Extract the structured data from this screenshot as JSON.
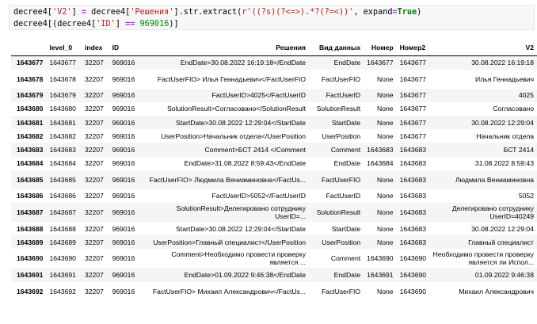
{
  "code": {
    "line1_a": "decree4[",
    "line1_b": "'V2'",
    "line1_c": "] ",
    "line1_d": "=",
    "line1_e": " decree4[",
    "line1_f": "'Решения'",
    "line1_g": "].str.extract(",
    "line1_h": "r'((?s)(?<=>).*?(?=<))'",
    "line1_i": ", expand",
    "line1_j": "=",
    "line1_k": "True",
    "line1_l": ")",
    "line2_a": "decree4[(decree4[",
    "line2_b": "'ID'",
    "line2_c": "] ",
    "line2_d": "==",
    "line2_e": " ",
    "line2_f": "969016",
    "line2_g": ")]"
  },
  "table": {
    "headers": [
      "",
      "level_0",
      "index",
      "ID",
      "Решения",
      "Вид данных",
      "Номер",
      "Номер2",
      "V2"
    ],
    "rows": [
      {
        "idx": "1643677",
        "lvl": "1643677",
        "index": "32207",
        "id": "969016",
        "res": "EndDate>30.08.2022 16:19:18</EndDate",
        "vid": "EndDate",
        "nom": "1643677",
        "nom2": "1643677",
        "v2": "30.08.2022 16:19:18"
      },
      {
        "idx": "1643678",
        "lvl": "1643678",
        "index": "32207",
        "id": "969016",
        "res": "FactUserFIO>          Илья Геннадьевич</FactUserFIO",
        "vid": "FactUserFIO",
        "nom": "None",
        "nom2": "1643677",
        "v2": "Илья Геннадьевич"
      },
      {
        "idx": "1643679",
        "lvl": "1643679",
        "index": "32207",
        "id": "969016",
        "res": "FactUserID>4025</FactUserID",
        "vid": "FactUserID",
        "nom": "None",
        "nom2": "1643677",
        "v2": "4025"
      },
      {
        "idx": "1643680",
        "lvl": "1643680",
        "index": "32207",
        "id": "969016",
        "res": "SolutionResult>Согласовано</SolutionResult",
        "vid": "SolutionResult",
        "nom": "None",
        "nom2": "1643677",
        "v2": "Согласовано"
      },
      {
        "idx": "1643681",
        "lvl": "1643681",
        "index": "32207",
        "id": "969016",
        "res": "StartDate>30.08.2022 12:29:04</StartDate",
        "vid": "StartDate",
        "nom": "None",
        "nom2": "1643677",
        "v2": "30.08.2022 12:29:04"
      },
      {
        "idx": "1643682",
        "lvl": "1643682",
        "index": "32207",
        "id": "969016",
        "res": "UserPosition>Начальник отдела</UserPosition",
        "vid": "UserPosition",
        "nom": "None",
        "nom2": "1643677",
        "v2": "Начальник отдела"
      },
      {
        "idx": "1643683",
        "lvl": "1643683",
        "index": "32207",
        "id": "969016",
        "res": "Comment>БСТ 2414        </Comment",
        "vid": "Comment",
        "nom": "1643683",
        "nom2": "1643683",
        "v2": "БСТ 2414"
      },
      {
        "idx": "1643684",
        "lvl": "1643684",
        "index": "32207",
        "id": "969016",
        "res": "EndDate>31.08.2022 8:59:43</EndDate",
        "vid": "EndDate",
        "nom": "1643684",
        "nom2": "1643683",
        "v2": "31.08.2022 8:59:43"
      },
      {
        "idx": "1643685",
        "lvl": "1643685",
        "index": "32207",
        "id": "969016",
        "res": "FactUserFIO>          Людмила Вениаминовна</FactUs...",
        "vid": "FactUserFIO",
        "nom": "None",
        "nom2": "1643683",
        "v2": "Людмила Вениаминовна"
      },
      {
        "idx": "1643686",
        "lvl": "1643686",
        "index": "32207",
        "id": "969016",
        "res": "FactUserID>5052</FactUserID",
        "vid": "FactUserID",
        "nom": "None",
        "nom2": "1643683",
        "v2": "5052"
      },
      {
        "idx": "1643687",
        "lvl": "1643687",
        "index": "32207",
        "id": "969016",
        "res": "SolutionResult>Делегировано сотруднику UserID=...",
        "vid": "SolutionResult",
        "nom": "None",
        "nom2": "1643683",
        "v2": "Делегировано сотруднику UserID=40249"
      },
      {
        "idx": "1643688",
        "lvl": "1643688",
        "index": "32207",
        "id": "969016",
        "res": "StartDate>30.08.2022 12:29:04</StartDate",
        "vid": "StartDate",
        "nom": "None",
        "nom2": "1643683",
        "v2": "30.08.2022 12:29:04"
      },
      {
        "idx": "1643689",
        "lvl": "1643689",
        "index": "32207",
        "id": "969016",
        "res": "UserPosition>Главный специалист</UserPosition",
        "vid": "UserPosition",
        "nom": "None",
        "nom2": "1643683",
        "v2": "Главный специалист"
      },
      {
        "idx": "1643690",
        "lvl": "1643690",
        "index": "32207",
        "id": "969016",
        "res": "Comment>Необходимо провести проверку является ...",
        "vid": "Comment",
        "nom": "1643690",
        "nom2": "1643690",
        "v2": "Необходимо провести проверку является ли Испол..."
      },
      {
        "idx": "1643691",
        "lvl": "1643691",
        "index": "32207",
        "id": "969016",
        "res": "EndDate>01.09.2022 9:46:38</EndDate",
        "vid": "EndDate",
        "nom": "1643691",
        "nom2": "1643690",
        "v2": "01.09.2022 9:46:38"
      },
      {
        "idx": "1643692",
        "lvl": "1643692",
        "index": "32207",
        "id": "969016",
        "res": "FactUserFIO>          Михаил Александрович</FactUs...",
        "vid": "FactUserFIO",
        "nom": "None",
        "nom2": "1643690",
        "v2": "Михаил Александрович"
      }
    ]
  }
}
